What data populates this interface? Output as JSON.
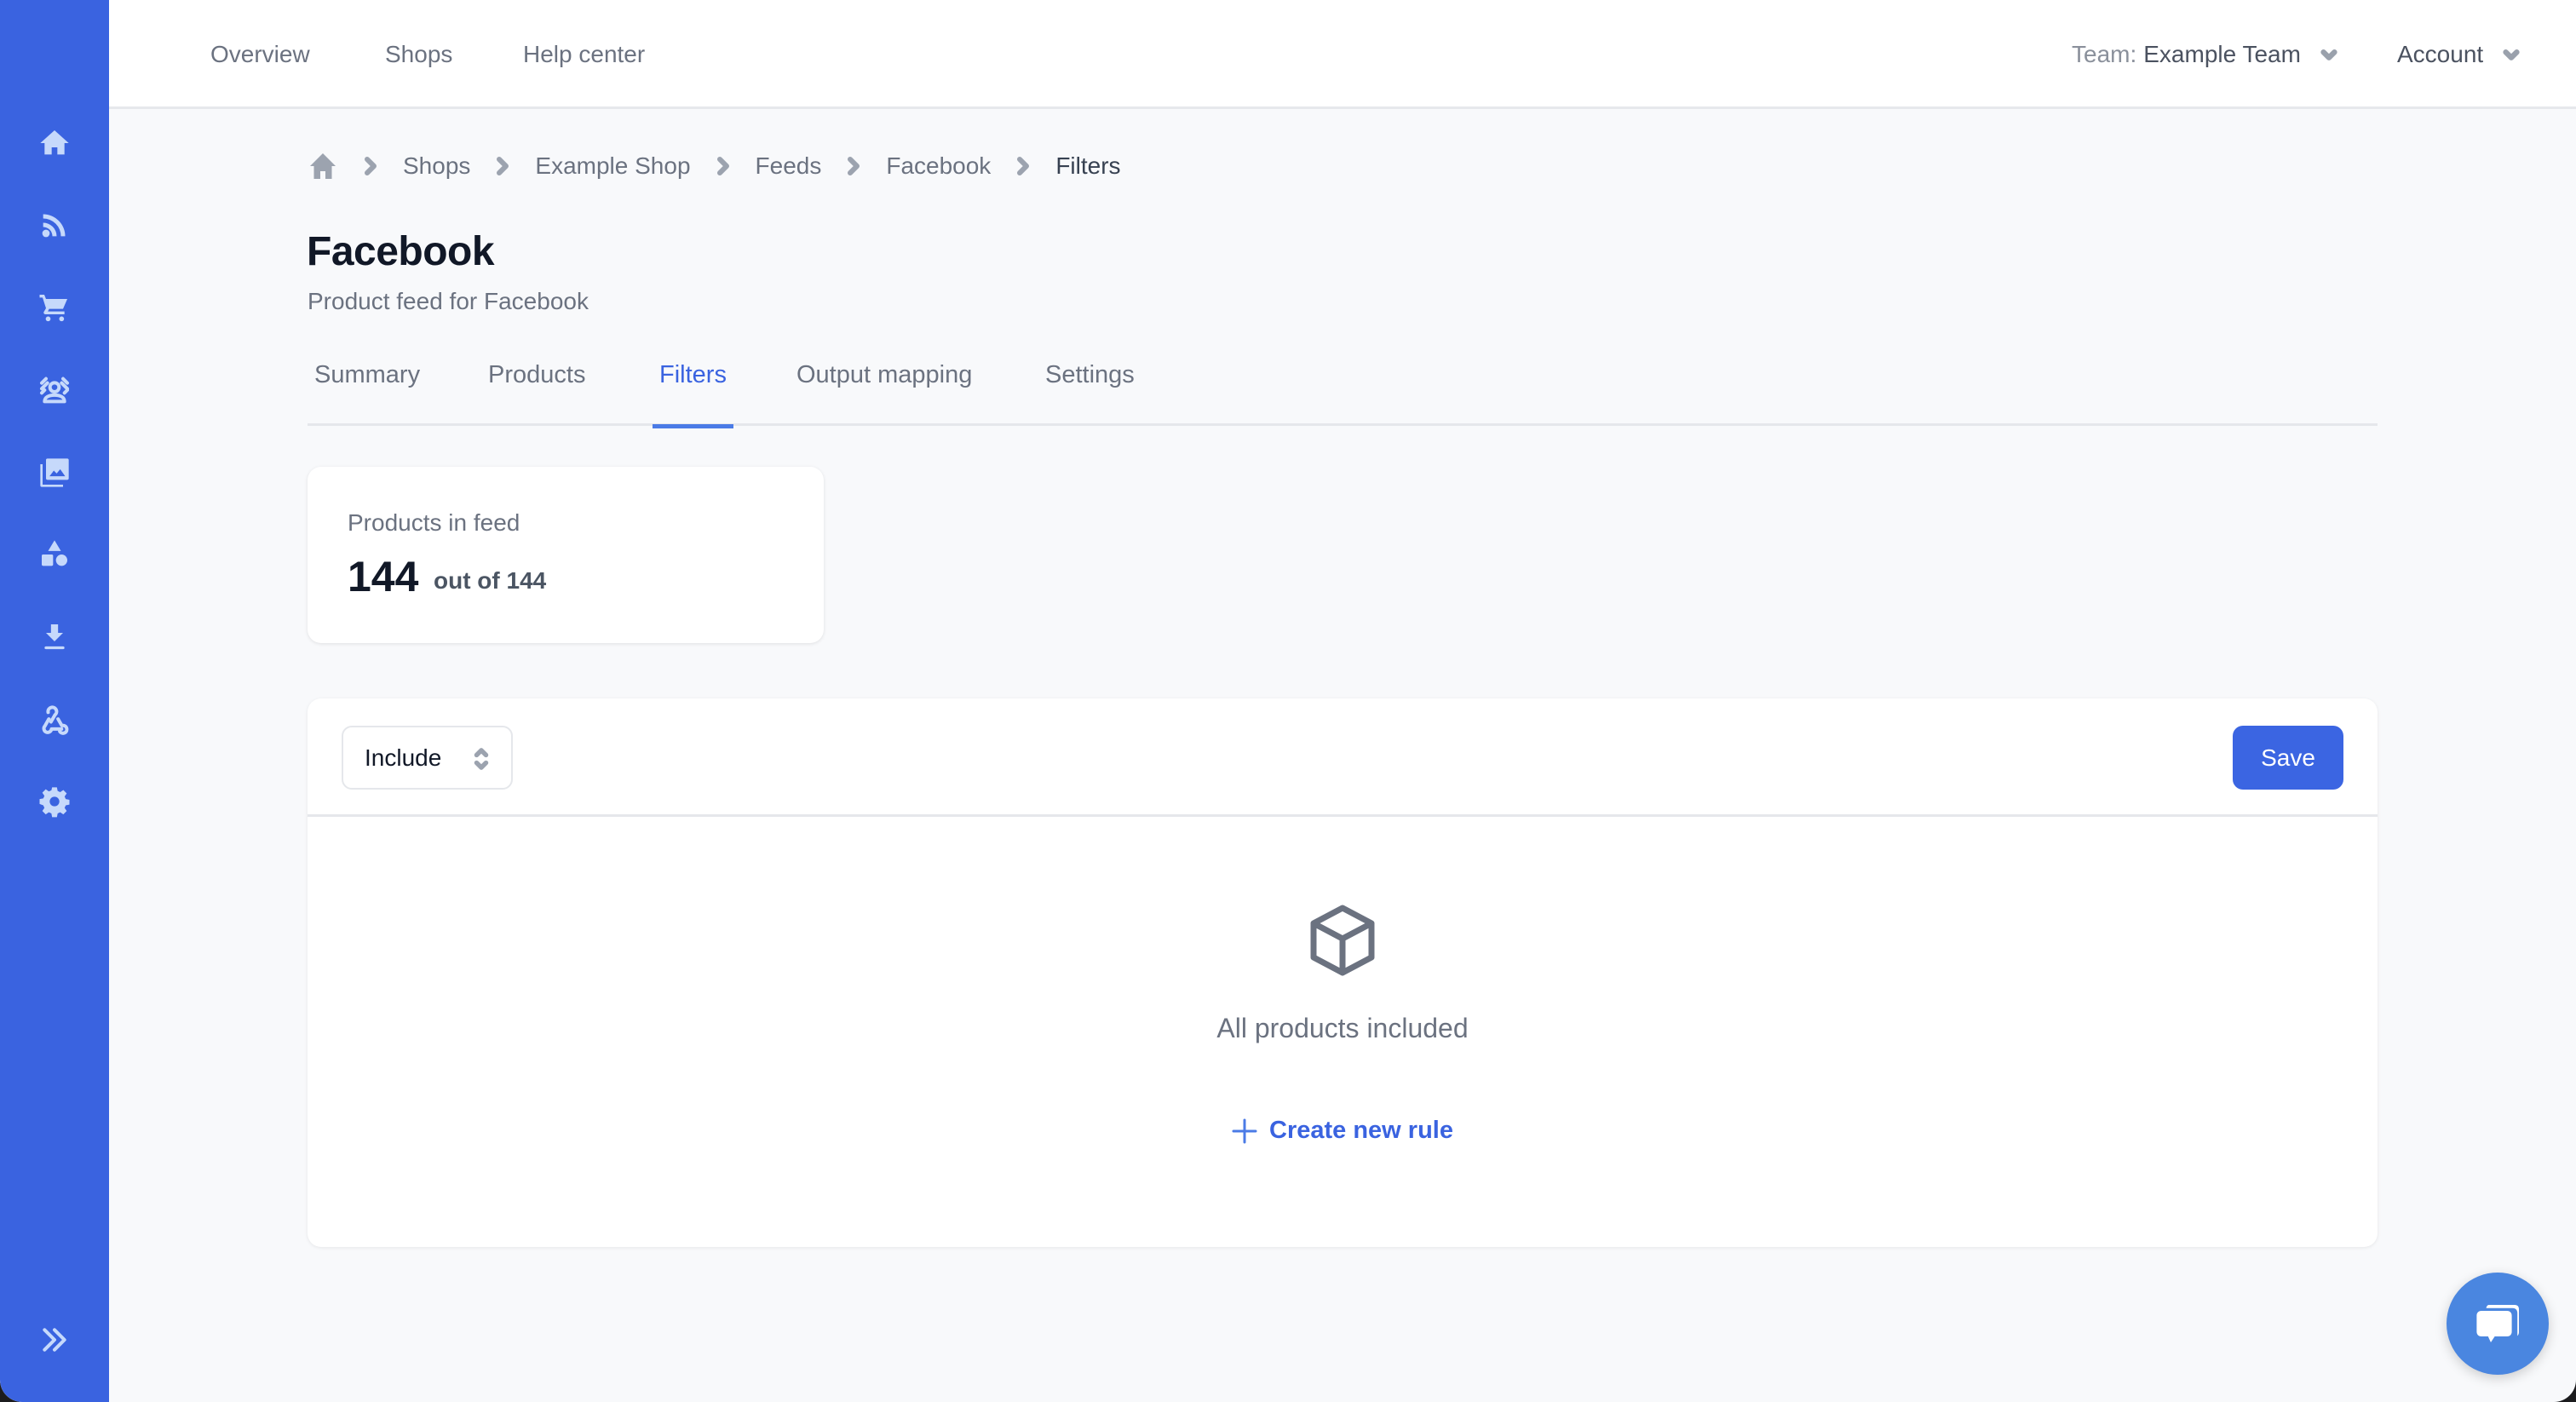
{
  "sidebar": {
    "items": [
      {
        "name": "home",
        "icon": "home-icon"
      },
      {
        "name": "feeds",
        "icon": "rss-icon"
      },
      {
        "name": "shops",
        "icon": "cart-icon"
      },
      {
        "name": "audiences",
        "icon": "user-focus-icon"
      },
      {
        "name": "media",
        "icon": "images-icon"
      },
      {
        "name": "categories",
        "icon": "shapes-icon"
      },
      {
        "name": "imports",
        "icon": "download-icon"
      },
      {
        "name": "webhooks",
        "icon": "webhook-icon"
      },
      {
        "name": "settings",
        "icon": "gear-icon"
      }
    ],
    "expand_icon": "chevrons-right-icon"
  },
  "topbar": {
    "nav": [
      "Overview",
      "Shops",
      "Help center"
    ],
    "team_label": "Team:",
    "team_name": "Example Team",
    "account_label": "Account"
  },
  "breadcrumb": {
    "home_icon": "home-icon",
    "items": [
      "Shops",
      "Example Shop",
      "Feeds",
      "Facebook"
    ],
    "current": "Filters"
  },
  "page": {
    "title": "Facebook",
    "subtitle": "Product feed for Facebook"
  },
  "tabs": [
    {
      "label": "Summary",
      "active": false
    },
    {
      "label": "Products",
      "active": false
    },
    {
      "label": "Filters",
      "active": true
    },
    {
      "label": "Output mapping",
      "active": false
    },
    {
      "label": "Settings",
      "active": false
    }
  ],
  "stats": {
    "label": "Products in feed",
    "value": "144",
    "total_text": "out of 144"
  },
  "filters": {
    "mode_selected": "Include",
    "save_label": "Save",
    "empty_icon": "cube-icon",
    "empty_text": "All products included",
    "create_rule_label": "Create new rule"
  },
  "chat": {
    "icon": "chat-bubbles-icon"
  },
  "colors": {
    "primary": "#3b65e2",
    "sidebar": "#3a63e0",
    "background": "#f8f9fb",
    "chat": "#4a86e0"
  }
}
